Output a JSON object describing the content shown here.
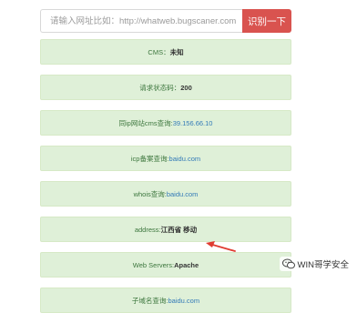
{
  "search": {
    "placeholder": "请输入网址比如：http://whatweb.bugscaner.com",
    "button_label": "识别一下"
  },
  "results": [
    {
      "name": "cms-row",
      "label": "CMS：",
      "value": "未知",
      "style": "bold"
    },
    {
      "name": "status-code-row",
      "label": "请求状态码：",
      "value": "200",
      "style": "bold"
    },
    {
      "name": "same-ip-row",
      "label": "同ip网站cms查询:",
      "value": "39.156.66.10",
      "style": "link"
    },
    {
      "name": "icp-row",
      "label": "icp备案查询:",
      "value": "baidu.com",
      "style": "link"
    },
    {
      "name": "whois-row",
      "label": "whois查询:",
      "value": "baidu.com",
      "style": "link"
    },
    {
      "name": "address-row",
      "label": "address:",
      "value": "江西省 移动",
      "style": "bold"
    },
    {
      "name": "web-servers-row",
      "label": "Web Servers:",
      "value": "Apache",
      "style": "bold"
    },
    {
      "name": "subdomain-row",
      "label": "子域名查询:",
      "value": "baidu.com",
      "style": "link"
    }
  ],
  "watermark": {
    "text": "WIN哥学安全",
    "icon": "wechat-icon"
  },
  "colors": {
    "button": "#d9534f",
    "row_background": "#dff0d8",
    "row_border": "#d6e9c6",
    "arrow": "#e03c31",
    "link": "#337ab7"
  }
}
